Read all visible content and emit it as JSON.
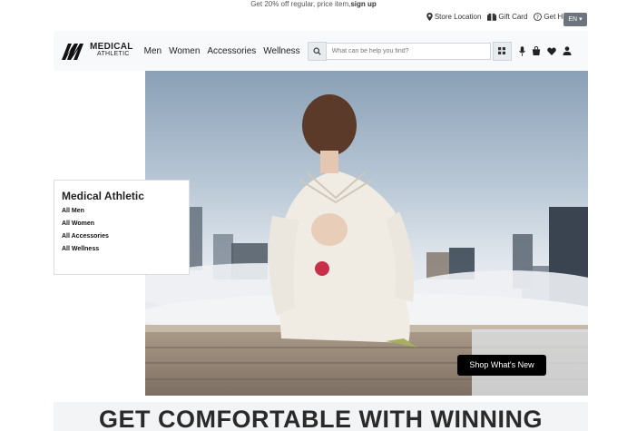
{
  "promo": {
    "text": "Get 20% off regular, price item,",
    "link": "sign up"
  },
  "utility": {
    "store_location": "Store Location",
    "gift_card": "Gift Card",
    "get_help": "Get Help",
    "language": "EN"
  },
  "brand": {
    "line1": "MEDICAL",
    "line2": "ATHLETIC"
  },
  "nav": {
    "items": [
      "Men",
      "Women",
      "Accessories",
      "Wellness"
    ]
  },
  "search": {
    "placeholder": "What can be help you find?"
  },
  "sidebar": {
    "title": "Medical Athletic",
    "items": [
      "All Men",
      "All Women",
      "All Accessories",
      "All Wellness"
    ]
  },
  "hero": {
    "cta": "Shop What's New"
  },
  "headline": "GET COMFORTABLE WITH WINNING",
  "colors": {
    "primary_button": "#000000",
    "nav_bg": "#f8f9fa",
    "lang_bg": "#6c757d"
  },
  "icons": [
    "map-marker-icon",
    "gift-card-icon",
    "help-icon",
    "globe-icon",
    "search-icon",
    "grid-icon",
    "microphone-icon",
    "shopping-bag-icon",
    "heart-icon",
    "user-icon"
  ]
}
